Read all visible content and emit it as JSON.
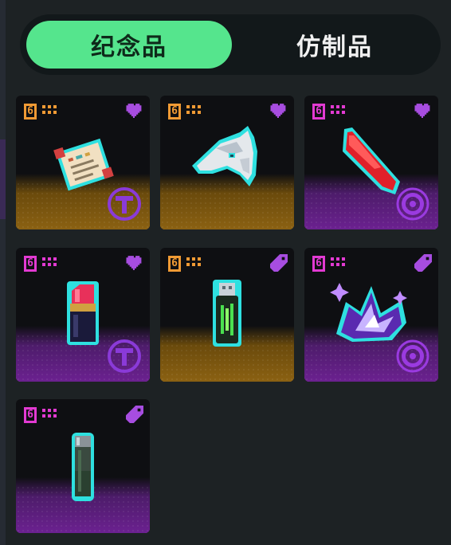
{
  "tabs": [
    {
      "label": "纪念品",
      "active": true
    },
    {
      "label": "仿制品",
      "active": false
    }
  ],
  "colors": {
    "accent": "#55e58d",
    "gold_rarity": "#f0a52c",
    "purple_rarity": "#c43ce6",
    "heart": "#a74de0"
  },
  "items": [
    {
      "tier": "6",
      "rarity": "gold",
      "corner": "heart-icon",
      "item": "scroll-icon",
      "badge": "t-token-icon"
    },
    {
      "tier": "6",
      "rarity": "gold",
      "corner": "heart-icon",
      "item": "horse-head-icon",
      "badge": ""
    },
    {
      "tier": "6",
      "rarity": "purple",
      "corner": "heart-icon",
      "item": "red-crystal-shard-icon",
      "badge": "vortex-icon"
    },
    {
      "tier": "6",
      "rarity": "purple",
      "corner": "heart-icon",
      "item": "lipstick-icon",
      "badge": "t-token-icon"
    },
    {
      "tier": "6",
      "rarity": "gold",
      "corner": "tag-icon",
      "item": "usb-drive-icon",
      "badge": ""
    },
    {
      "tier": "6",
      "rarity": "purple",
      "corner": "tag-icon",
      "item": "purple-crystal-splash-icon",
      "badge": "vortex-icon"
    },
    {
      "tier": "6",
      "rarity": "purple",
      "corner": "tag-icon",
      "item": "vial-icon",
      "badge": ""
    }
  ]
}
